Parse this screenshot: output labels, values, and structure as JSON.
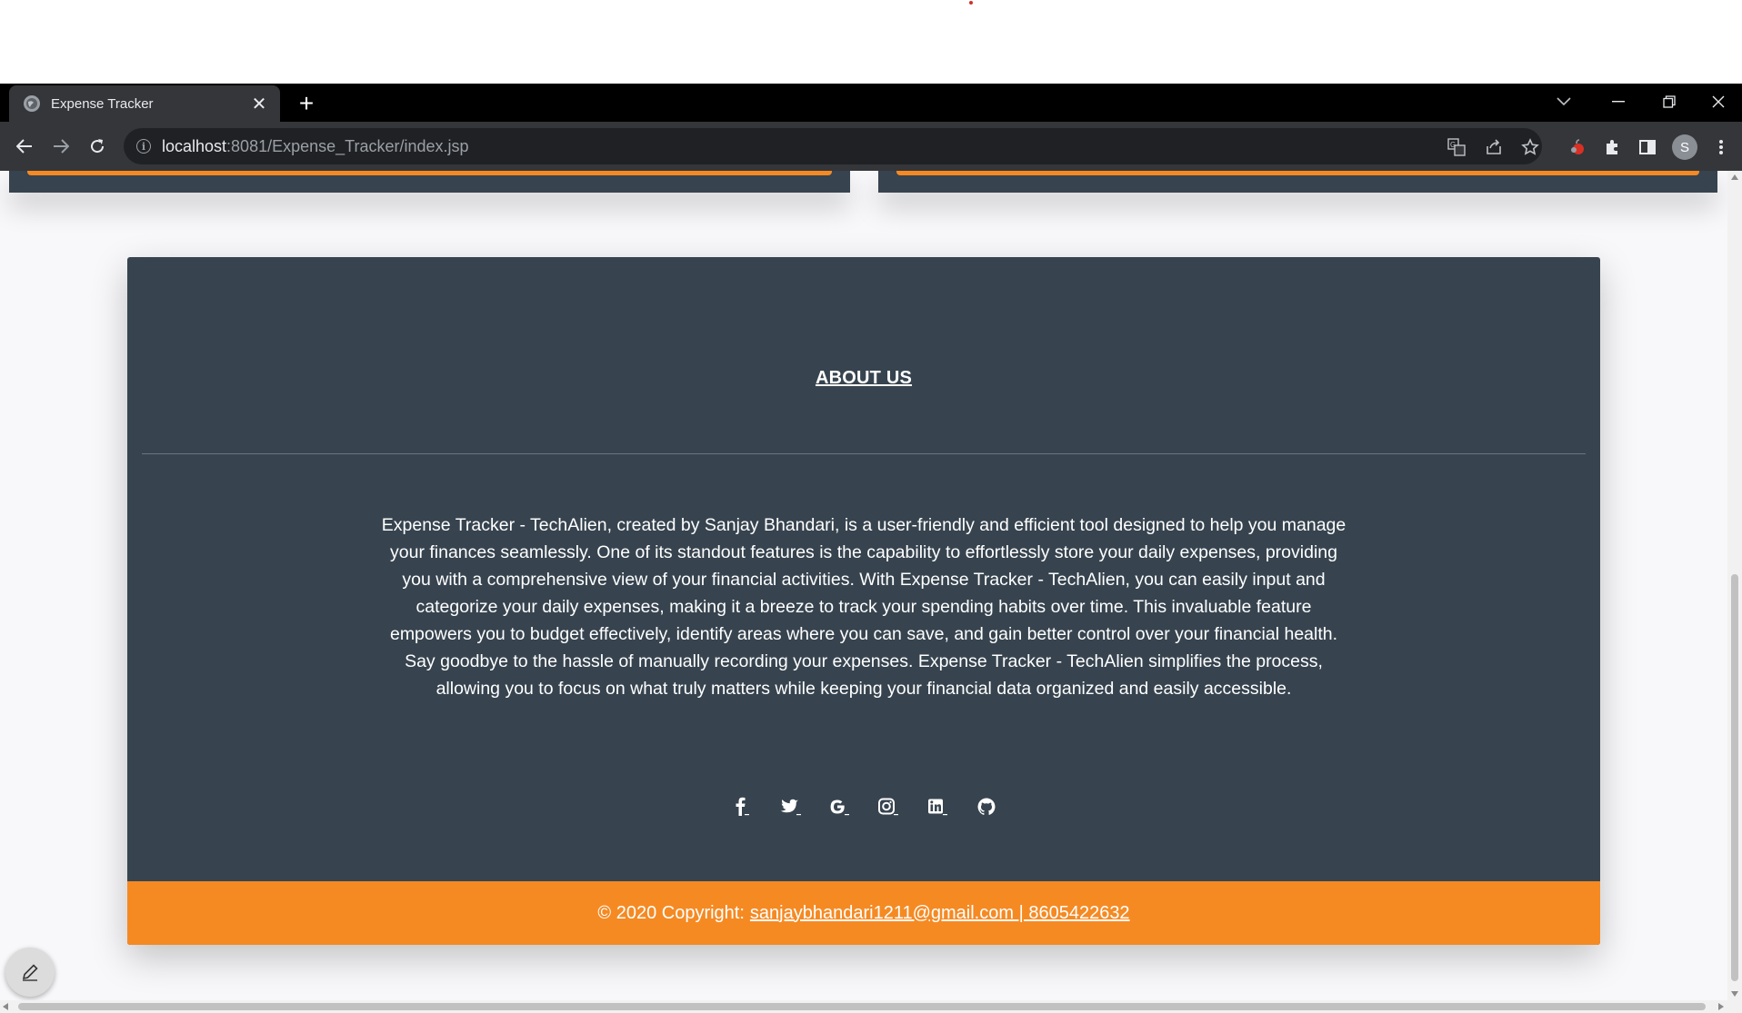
{
  "browser": {
    "tab_title": "Expense Tracker",
    "new_tab_symbol": "+",
    "close_symbol": "✕",
    "url_host": "localhost",
    "url_rest": ":8081/Expense_Tracker/index.jsp",
    "profile_initial": "S"
  },
  "about": {
    "title": "ABOUT US",
    "text": "Expense Tracker - TechAlien, created by Sanjay Bhandari, is a user-friendly and efficient tool designed to help you manage your finances seamlessly. One of its standout features is the capability to effortlessly store your daily expenses, providing you with a comprehensive view of your financial activities. With Expense Tracker - TechAlien, you can easily input and categorize your daily expenses, making it a breeze to track your spending habits over time. This invaluable feature empowers you to budget effectively, identify areas where you can save, and gain better control over your financial health. Say goodbye to the hassle of manually recording your expenses. Expense Tracker - TechAlien simplifies the process, allowing you to focus on what truly matters while keeping your financial data organized and easily accessible."
  },
  "social_links": [
    {
      "icon": "facebook-icon"
    },
    {
      "icon": "twitter-icon"
    },
    {
      "icon": "google-icon"
    },
    {
      "icon": "instagram-icon"
    },
    {
      "icon": "linkedin-icon"
    },
    {
      "icon": "github-icon"
    }
  ],
  "footer": {
    "copyright_prefix": "© 2020 Copyright:",
    "contact_link": "sanjaybhandari1211@gmail.com | 8605422632"
  },
  "colors": {
    "footer_bg": "#37444f",
    "accent_orange": "#f58a23",
    "chrome_dark": "#35363a"
  }
}
